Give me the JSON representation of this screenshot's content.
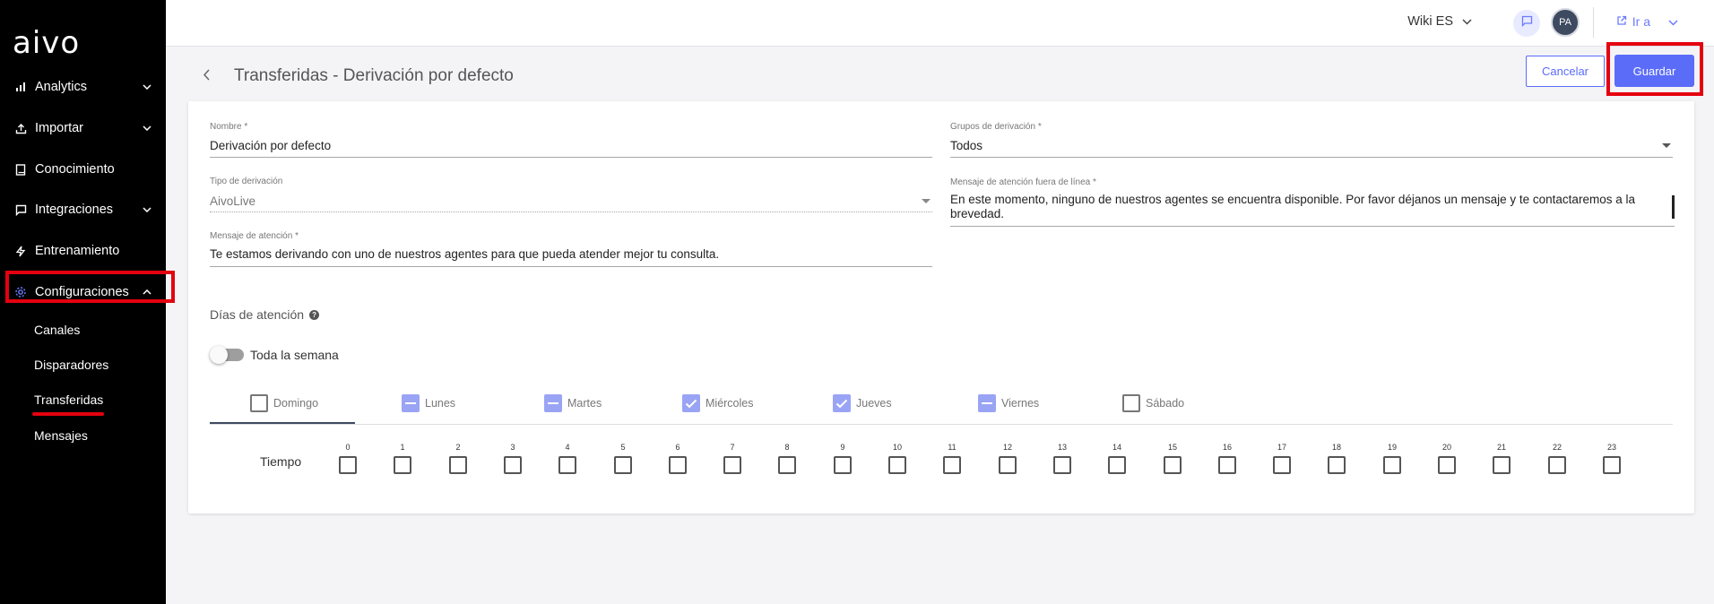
{
  "sidebar": {
    "logo": "aivo",
    "items": [
      {
        "label": "Analytics",
        "icon": "bar-chart-icon",
        "chevron": "down"
      },
      {
        "label": "Importar",
        "icon": "upload-icon",
        "chevron": "down"
      },
      {
        "label": "Conocimiento",
        "icon": "book-icon",
        "chevron": ""
      },
      {
        "label": "Integraciones",
        "icon": "chat-bubble-icon",
        "chevron": "down"
      },
      {
        "label": "Entrenamiento",
        "icon": "lightning-icon",
        "chevron": ""
      },
      {
        "label": "Configuraciones",
        "icon": "gear-icon",
        "chevron": "up"
      }
    ],
    "subitems": [
      "Canales",
      "Disparadores",
      "Transferidas",
      "Mensajes"
    ],
    "active_subitem": "Transferidas",
    "accent_color": "#6b7bff",
    "highlight_color": "#e4000f"
  },
  "topbar": {
    "wiki_label": "Wiki ES",
    "avatar_initials": "PA",
    "goto_label": "Ir a"
  },
  "header": {
    "title": "Transferidas - Derivación por defecto",
    "cancel_label": "Cancelar",
    "save_label": "Guardar",
    "primary_color": "#5b6cf9"
  },
  "form": {
    "nombre": {
      "label": "Nombre *",
      "value": "Derivación por defecto"
    },
    "grupos": {
      "label": "Grupos de derivación *",
      "value": "Todos"
    },
    "tipo": {
      "label": "Tipo de derivación",
      "value": "AivoLive"
    },
    "mensaje_fuera": {
      "label": "Mensaje de atención fuera de línea *",
      "value": "En este momento, ninguno de nuestros agentes se encuentra disponible. Por favor déjanos un mensaje y te contactaremos a la brevedad."
    },
    "mensaje": {
      "label": "Mensaje de atención *",
      "value": "Te estamos derivando con uno de nuestros agentes para que pueda atender mejor tu consulta."
    }
  },
  "schedule": {
    "section_title": "Días de atención",
    "toggle_label": "Toda la semana",
    "toggle_on": false,
    "days": [
      {
        "label": "Domingo",
        "state": "unchecked"
      },
      {
        "label": "Lunes",
        "state": "partial"
      },
      {
        "label": "Martes",
        "state": "partial"
      },
      {
        "label": "Miércoles",
        "state": "checked"
      },
      {
        "label": "Jueves",
        "state": "checked"
      },
      {
        "label": "Viernes",
        "state": "partial"
      },
      {
        "label": "Sábado",
        "state": "unchecked"
      }
    ],
    "active_day": "Domingo",
    "time_label": "Tiempo",
    "hours": [
      "0",
      "1",
      "2",
      "3",
      "4",
      "5",
      "6",
      "7",
      "8",
      "9",
      "10",
      "11",
      "12",
      "13",
      "14",
      "15",
      "16",
      "17",
      "18",
      "19",
      "20",
      "21",
      "22",
      "23"
    ]
  }
}
